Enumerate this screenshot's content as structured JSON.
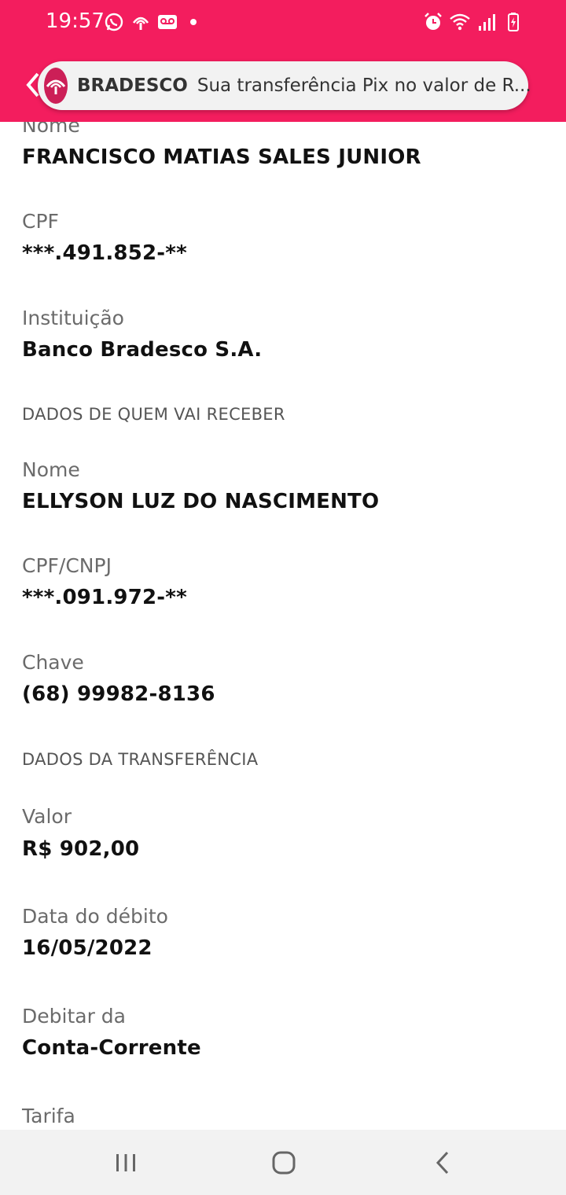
{
  "status_bar": {
    "time": "19:57",
    "left_icons": [
      "whatsapp-icon",
      "bradesco-icon",
      "voicemail-icon"
    ],
    "right_icons": [
      "alarm-icon",
      "wifi-icon",
      "signal-icon",
      "battery-charging-icon"
    ],
    "background_color": "#f31d5e"
  },
  "notification": {
    "app_name": "BRADESCO",
    "text": "Sua transferência Pix no valor de R..."
  },
  "payer": {
    "name_label": "Nome",
    "name_value": "FRANCISCO MATIAS SALES JUNIOR",
    "cpf_label": "CPF",
    "cpf_value": "***.491.852-**",
    "institution_label": "Instituição",
    "institution_value": "Banco Bradesco S.A."
  },
  "receiver": {
    "section_title": "DADOS DE QUEM VAI RECEBER",
    "name_label": "Nome",
    "name_value": "ELLYSON LUZ DO NASCIMENTO",
    "doc_label": "CPF/CNPJ",
    "doc_value": "***.091.972-**",
    "key_label": "Chave",
    "key_value": "(68) 99982-8136"
  },
  "transfer": {
    "section_title": "DADOS DA TRANSFERÊNCIA",
    "amount_label": "Valor",
    "amount_value": "R$ 902,00",
    "date_label": "Data do débito",
    "date_value": "16/05/2022",
    "debit_label": "Debitar da",
    "debit_value": "Conta-Corrente",
    "fee_label": "Tarifa"
  },
  "nav_bar": {
    "buttons": [
      "recents-icon",
      "home-icon",
      "back-icon"
    ]
  }
}
